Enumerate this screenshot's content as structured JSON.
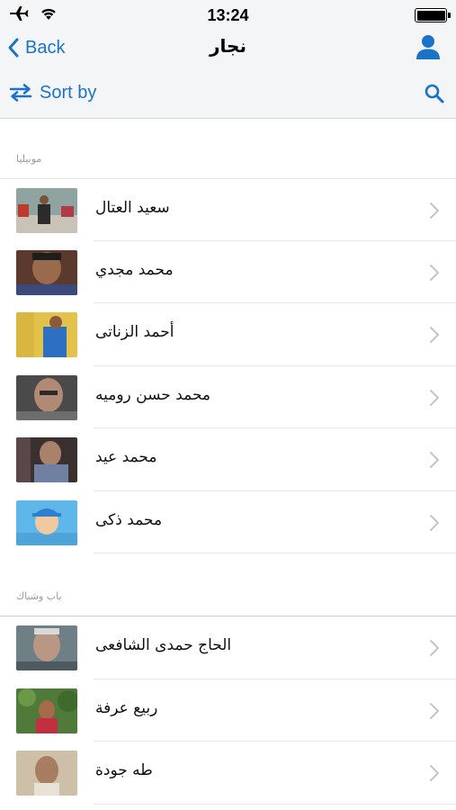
{
  "status_bar": {
    "time": "13:24",
    "icons": [
      "airplane-icon",
      "wifi-icon",
      "battery-icon"
    ],
    "battery_level": 1.0
  },
  "nav": {
    "back_label": "Back",
    "title": "نجار",
    "right_icon": "person-icon"
  },
  "toolbar": {
    "sort_label": "Sort by",
    "sort_icon": "swap-arrows-icon",
    "search_icon": "search-icon"
  },
  "colors": {
    "accent": "#1a73c9",
    "bar_background": "#f4f5f6",
    "section_text": "#9b9b9b",
    "separator": "#e6e6e6"
  },
  "sections": [
    {
      "header": "موبيليا",
      "items": [
        {
          "name": "سعيد العتال"
        },
        {
          "name": "محمد مجدي"
        },
        {
          "name": "أحمد الزناتى"
        },
        {
          "name": "محمد حسن روميه"
        },
        {
          "name": "محمد عيد"
        },
        {
          "name": "محمد ذكى"
        }
      ]
    },
    {
      "header": "باب وشباك",
      "items": [
        {
          "name": "الحاج حمدى الشافعى"
        },
        {
          "name": "ربيع عرفة"
        },
        {
          "name": "طه جودة"
        }
      ]
    }
  ]
}
